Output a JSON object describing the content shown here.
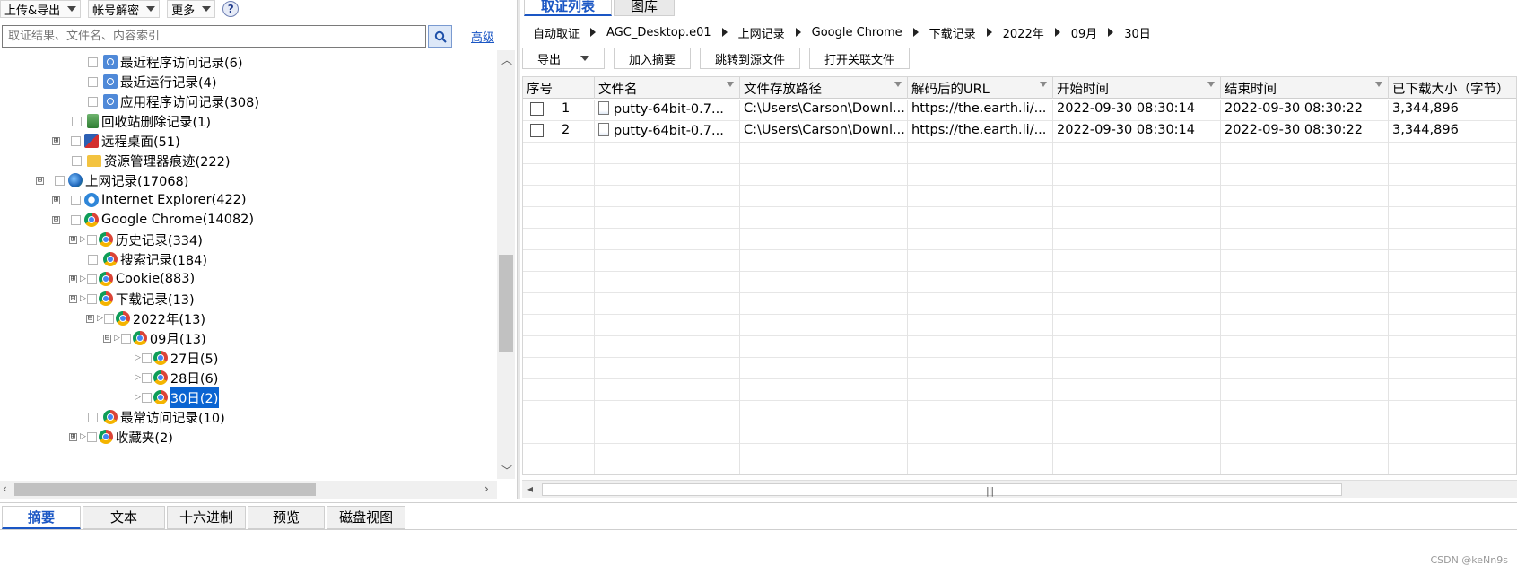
{
  "left": {
    "menu": {
      "upload_export": "上传&导出",
      "decrypt": "帐号解密",
      "more": "更多",
      "help": "?"
    },
    "search": {
      "placeholder": "取证结果、文件名、内容索引",
      "advanced": "高级"
    },
    "tree": [
      {
        "label": "最近程序访问记录(6)",
        "icon": "clock-icon"
      },
      {
        "label": "最近运行记录(4)",
        "icon": "clock-icon"
      },
      {
        "label": "应用程序访问记录(308)",
        "icon": "clock-icon"
      },
      {
        "label": "回收站删除记录(1)",
        "icon": "recycle-bin-icon"
      },
      {
        "label": "远程桌面(51)",
        "icon": "remote-desktop-icon"
      },
      {
        "label": "资源管理器痕迹(222)",
        "icon": "folder-icon"
      },
      {
        "label": "上网记录(17068)",
        "icon": "globe-icon"
      },
      {
        "label": "Internet Explorer(422)",
        "icon": "ie-icon"
      },
      {
        "label": "Google Chrome(14082)",
        "icon": "chrome-icon"
      },
      {
        "label": "历史记录(334)",
        "icon": "chrome-icon"
      },
      {
        "label": "搜索记录(184)",
        "icon": "chrome-icon"
      },
      {
        "label": "Cookie(883)",
        "icon": "chrome-icon"
      },
      {
        "label": "下载记录(13)",
        "icon": "chrome-icon"
      },
      {
        "label": "2022年(13)",
        "icon": "chrome-icon"
      },
      {
        "label": "09月(13)",
        "icon": "chrome-icon"
      },
      {
        "label": "27日(5)",
        "icon": "chrome-icon"
      },
      {
        "label": "28日(6)",
        "icon": "chrome-icon"
      },
      {
        "label": "30日(2)",
        "icon": "chrome-icon",
        "selected": true
      },
      {
        "label": "最常访问记录(10)",
        "icon": "chrome-icon"
      },
      {
        "label": "收藏夹(2)",
        "icon": "chrome-icon"
      }
    ],
    "expander": {
      "plus": "⊞",
      "minus": "⊟"
    }
  },
  "right": {
    "tabs": [
      "取证列表",
      "图库"
    ],
    "breadcrumb": [
      "自动取证",
      "AGC_Desktop.e01",
      "上网记录",
      "Google Chrome",
      "下载记录",
      "2022年",
      "09月",
      "30日"
    ],
    "toolbar": {
      "export": "导出",
      "add_summary": "加入摘要",
      "jump_source": "跳转到源文件",
      "open_related": "打开关联文件"
    },
    "table": {
      "columns": [
        "序号",
        "文件名",
        "文件存放路径",
        "解码后的URL",
        "开始时间",
        "结束时间",
        "已下载大小（字节）"
      ],
      "rows": [
        [
          "1",
          "putty-64bit-0.7...",
          "C:\\Users\\Carson\\Downl...",
          "https://the.earth.li/...",
          "2022-09-30 08:30:14",
          "2022-09-30 08:30:22",
          "3,344,896"
        ],
        [
          "2",
          "putty-64bit-0.7...",
          "C:\\Users\\Carson\\Downl...",
          "https://the.earth.li/...",
          "2022-09-30 08:30:14",
          "2022-09-30 08:30:22",
          "3,344,896"
        ]
      ]
    },
    "scroll_grip": "|||"
  },
  "bottom": {
    "tabs": [
      "摘要",
      "文本",
      "十六进制",
      "预览",
      "磁盘视图"
    ],
    "watermark": "CSDN @keNn9s"
  },
  "colors": {
    "accent": "#1a56c4",
    "selection": "#0a64d2"
  }
}
